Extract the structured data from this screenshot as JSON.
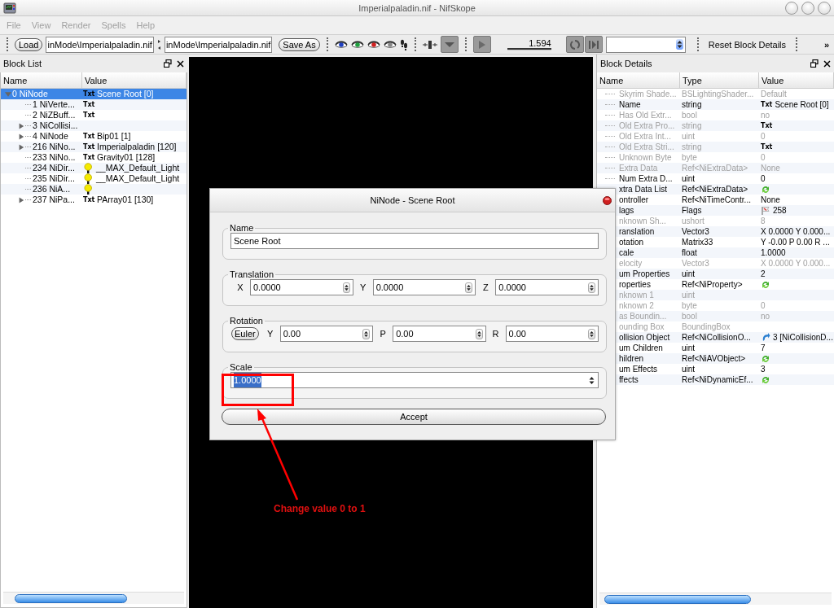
{
  "window": {
    "title": "Imperialpaladin.nif - NifSkope"
  },
  "menu": [
    "File",
    "View",
    "Render",
    "Spells",
    "Help"
  ],
  "toolbar": {
    "load_button": "Load",
    "path_1": "inMode\\Imperialpaladin.nif",
    "path_2": "inMode\\Imperialpaladin.nif",
    "save_button": "Save As",
    "time_slider": {
      "level": 1,
      "reading": "1.594"
    },
    "reset_button": "Reset Block Details",
    "overflow": "»"
  },
  "block_list": {
    "title": "Block List",
    "columns": [
      "Name",
      "Value"
    ],
    "rows": [
      {
        "name": "0 NiNode",
        "badge": "Txt",
        "value": "Scene Root [0]",
        "kind": "branch",
        "expanded": true,
        "selected": true,
        "children": [
          {
            "name": "1 NiVerte...",
            "badge": "Txt",
            "kind": "leaf",
            "selected": false
          },
          {
            "name": "2 NiZBuff...",
            "badge": "Txt",
            "kind": "leaf",
            "selected": false
          },
          {
            "name": "3 NiCollisi...",
            "kind": "branch",
            "expanded": false,
            "selected": false
          },
          {
            "name": "4 NiNode",
            "badge": "Txt",
            "value": "Bip01 [1]",
            "kind": "branch",
            "expanded": false,
            "selected": false
          },
          {
            "name": "216 NiNo...",
            "badge": "Txt",
            "value": "Imperialpaladin [120]",
            "kind": "branch",
            "expanded": false,
            "selected": false
          },
          {
            "name": "233 NiNo...",
            "badge": "Txt",
            "value": "Gravity01 [128]",
            "kind": "leaf",
            "selected": false
          },
          {
            "name": "234 NiDir...",
            "value": "__MAX_Default_Light",
            "kind": "lamp",
            "selected": false
          },
          {
            "name": "235 NiDir...",
            "value": "__MAX_Default_Light",
            "kind": "lamp",
            "selected": false
          },
          {
            "name": "236 NiA...",
            "kind": "lamp",
            "selected": false
          },
          {
            "name": "237 NiPa...",
            "badge": "Txt",
            "value": "PArray01 [130]",
            "kind": "branch",
            "expanded": false,
            "selected": false
          }
        ]
      }
    ]
  },
  "block_details": {
    "title": "Block Details",
    "columns": [
      "Name",
      "Type",
      "Value"
    ],
    "rows": [
      {
        "name": "Skyrim Shade...",
        "type": "BSLightingShader...",
        "value": "Default",
        "disabled": true
      },
      {
        "name": "Name",
        "type": "string",
        "badge": "Txt",
        "value": "Scene Root [0]",
        "disabled": false
      },
      {
        "name": "Has Old Extr...",
        "type": "bool",
        "value": "no",
        "disabled": true
      },
      {
        "name": "Old Extra Pro...",
        "type": "string",
        "badge": "Txt",
        "disabled": true
      },
      {
        "name": "Old Extra Int...",
        "type": "uint",
        "value": "0",
        "disabled": true
      },
      {
        "name": "Old Extra Stri...",
        "type": "string",
        "badge": "Txt",
        "disabled": true
      },
      {
        "name": "Unknown Byte",
        "type": "byte",
        "value": "0",
        "disabled": true
      },
      {
        "name": "Extra Data",
        "type": "Ref<NiExtraData>",
        "value": "None",
        "disabled": true
      },
      {
        "name": "Num Extra D...",
        "type": "uint",
        "value": "0",
        "disabled": false
      },
      {
        "name": "xtra Data List",
        "type": "Ref<NiExtraData>",
        "kind": "ref",
        "disabled": false
      },
      {
        "name": "ontroller",
        "type": "Ref<NiTimeContr...",
        "value": "None",
        "disabled": false
      },
      {
        "name": "lags",
        "type": "Flags",
        "kind": "flags",
        "value": "258",
        "disabled": false
      },
      {
        "name": "nknown Sh...",
        "type": "ushort",
        "value": "8",
        "disabled": true
      },
      {
        "name": "ranslation",
        "type": "Vector3",
        "value": "X 0.0000 Y 0.000...",
        "disabled": false
      },
      {
        "name": "otation",
        "type": "Matrix33",
        "value": "Y -0.00 P 0.00 R ...",
        "disabled": false
      },
      {
        "name": "cale",
        "type": "float",
        "value": "1.0000",
        "disabled": false
      },
      {
        "name": "elocity",
        "type": "Vector3",
        "value": "X 0.0000 Y 0.000...",
        "disabled": true
      },
      {
        "name": "um Properties",
        "type": "uint",
        "value": "2",
        "disabled": false
      },
      {
        "name": "roperties",
        "type": "Ref<NiProperty>",
        "kind": "ref",
        "disabled": false
      },
      {
        "name": "nknown 1",
        "type": "uint",
        "disabled": true
      },
      {
        "name": "nknown 2",
        "type": "byte",
        "value": "0",
        "disabled": true
      },
      {
        "name": "as Boundin...",
        "type": "bool",
        "value": "no",
        "disabled": true
      },
      {
        "name": "ounding Box",
        "type": "BoundingBox",
        "disabled": true
      },
      {
        "name": "ollision Object",
        "type": "Ref<NiCollisionO...",
        "kind": "link",
        "value": "3 [NiCollisionD...",
        "disabled": false
      },
      {
        "name": "um Children",
        "type": "uint",
        "value": "7",
        "disabled": false
      },
      {
        "name": "hildren",
        "type": "Ref<NiAVObject>",
        "kind": "ref",
        "disabled": false
      },
      {
        "name": "um Effects",
        "type": "uint",
        "value": "3",
        "disabled": false
      },
      {
        "name": "ffects",
        "type": "Ref<NiDynamicEf...",
        "kind": "ref",
        "disabled": false
      }
    ]
  },
  "dialog": {
    "title": "NiNode - Scene Root",
    "groups": [
      {
        "kind": "text",
        "legend": "Name",
        "value": "Scene Root"
      },
      {
        "kind": "vector",
        "legend": "Translation",
        "fields": [
          {
            "label": "X",
            "value": "0.0000"
          },
          {
            "label": "Y",
            "value": "0.0000"
          },
          {
            "label": "Z",
            "value": "0.0000"
          }
        ]
      },
      {
        "kind": "rotation",
        "legend": "Rotation",
        "button": "Euler",
        "fields": [
          {
            "label": "Y",
            "value": "0.00"
          },
          {
            "label": "P",
            "value": "0.00"
          },
          {
            "label": "R",
            "value": "0.00"
          }
        ]
      },
      {
        "kind": "scale",
        "legend": "Scale",
        "value": "1.0000",
        "text_selected": true
      }
    ],
    "accept_button": "Accept"
  },
  "annotation": {
    "text": "Change value 0 to 1"
  }
}
